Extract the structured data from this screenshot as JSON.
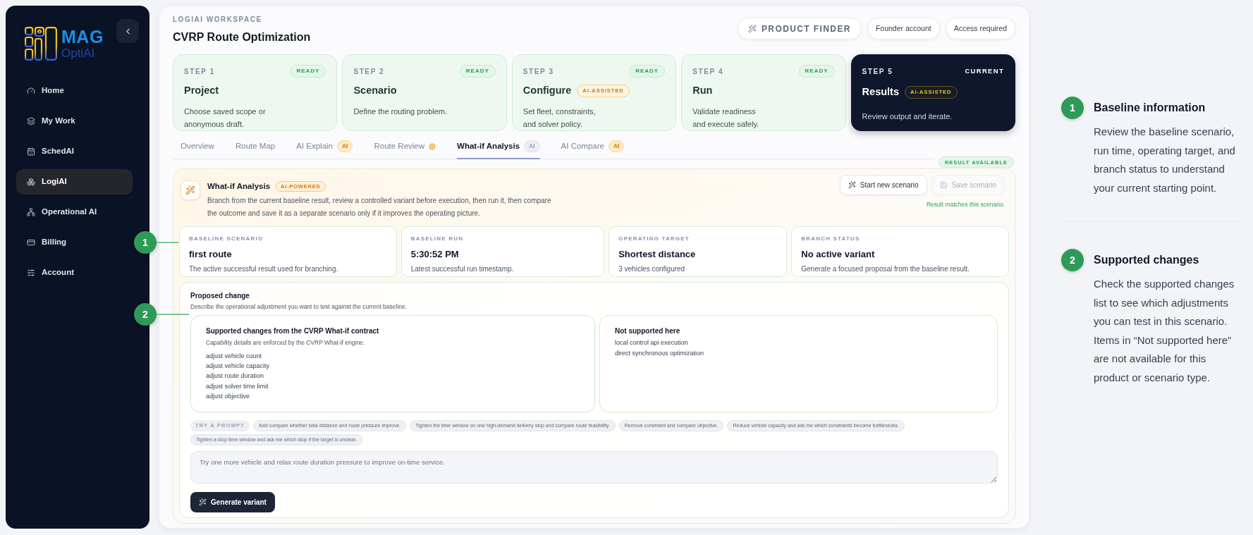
{
  "sidebar": {
    "logo": {
      "title": "MAG",
      "subtitle": "OptiAI"
    },
    "items": [
      {
        "label": "Home",
        "selected": false
      },
      {
        "label": "My Work",
        "selected": false
      },
      {
        "label": "SchedAI",
        "selected": false
      },
      {
        "label": "LogiAI",
        "selected": true
      },
      {
        "label": "Operational AI",
        "selected": false
      },
      {
        "label": "Billing",
        "selected": false
      },
      {
        "label": "Account",
        "selected": false
      }
    ]
  },
  "header": {
    "eyebrow": "LOGIAI WORKSPACE",
    "title": "CVRP Route Optimization",
    "actions": [
      {
        "kind": "finder",
        "label": "PRODUCT FINDER"
      },
      {
        "kind": "pill",
        "label": "Founder account"
      },
      {
        "kind": "pill",
        "label": "Access required"
      }
    ]
  },
  "steps": [
    {
      "step": "STEP 1",
      "status": "READY",
      "title": "Project",
      "description": "Choose saved scope or\nanonymous draft.",
      "current": false
    },
    {
      "step": "STEP 2",
      "status": "READY",
      "title": "Scenario",
      "description": "Define the routing problem.",
      "current": false
    },
    {
      "step": "STEP 3",
      "status": "READY",
      "title": "Configure",
      "ai_badge": "AI-ASSISTED",
      "description": "Set fleet, constraints,\nand solver policy.",
      "current": false
    },
    {
      "step": "STEP 4",
      "status": "READY",
      "title": "Run",
      "description": "Validate readiness\nand execute safely.",
      "current": false
    },
    {
      "step": "STEP 5",
      "status": "CURRENT",
      "title": "Results",
      "ai_badge": "AI-ASSISTED",
      "description": "Review output and iterate.",
      "current": true
    }
  ],
  "tabs": [
    {
      "label": "Overview",
      "kind": "plain",
      "selected": false
    },
    {
      "label": "Route Map",
      "kind": "plain",
      "selected": false
    },
    {
      "label": "AI Explain",
      "kind": "ai",
      "badge": "AI",
      "selected": false
    },
    {
      "label": "Route Review",
      "kind": "dot",
      "selected": false
    },
    {
      "label": "What-if Analysis",
      "kind": "ai",
      "badge": "AI",
      "selected": true
    },
    {
      "label": "AI Compare",
      "kind": "ai",
      "badge": "AI",
      "selected": false
    }
  ],
  "result_status": "RESULT AVAILABLE",
  "whatif": {
    "title": "What-if Analysis",
    "badge": "AI-POWERED",
    "description": "Branch from the current baseline result, review a controlled variant before execution, then run it, then compare the outcome and save it as a separate scenario only if it improves the operating picture.",
    "actions": [
      {
        "kind": "new",
        "label": "Start new scenario",
        "disabled": false
      },
      {
        "kind": "save",
        "label": "Save scenario",
        "disabled": true
      }
    ],
    "result_note": "Result matches this scenario."
  },
  "baseline_cards": [
    {
      "label": "BASELINE SCENARIO",
      "value": "first route",
      "note": "The active successful result used for branching."
    },
    {
      "label": "BASELINE RUN",
      "value": "5:30:52 PM",
      "note": "Latest successful run timestamp."
    },
    {
      "label": "OPERATING TARGET",
      "value": "Shortest distance",
      "note": "3 vehicles configured"
    },
    {
      "label": "BRANCH STATUS",
      "value": "No active variant",
      "note": "Generate a focused proposal from the baseline result."
    }
  ],
  "proposed_change": {
    "title": "Proposed change",
    "description": "Describe the operational adjustment you want to test against the current baseline.",
    "supported": {
      "title": "Supported changes from the CVRP What-if contract",
      "note": "Capability details are enforced by the CVRP What-if engine.",
      "items": [
        "adjust vehicle count",
        "adjust vehicle capacity",
        "adjust route duration",
        "adjust solver time limit",
        "adjust objective"
      ]
    },
    "not_supported": {
      "title": "Not supported here",
      "items": [
        "local control api execution",
        "direct synchronous optimization"
      ]
    },
    "prompt_label": "TRY A PROMPT",
    "prompts": [
      "Add compare whether total distance and route pressure improve.",
      "Tighten the time window on one high-demand delivery stop and compare route feasibility.",
      "Remove constraint and compare objective.",
      "Reduce vehicle capacity and ask me which constraints become bottlenecks.",
      "Tighten a stop time window and ask me which stop if the target is unclear."
    ],
    "input": {
      "placeholder": "Try one more vehicle and relax route duration pressure to improve on-time service."
    },
    "submit": "Generate variant"
  },
  "callout_markers": [
    {
      "number": "1"
    },
    {
      "number": "2"
    }
  ],
  "guide": [
    {
      "number": "1",
      "title": "Baseline information",
      "text": "Review the baseline scenario, run time, operating target, and branch status to understand your current starting point."
    },
    {
      "number": "2",
      "title": "Supported changes",
      "text": "Check the supported changes list to see which adjustments you can test in this scenario. Items in “Not supported here” are not available for this product or scenario type."
    }
  ]
}
